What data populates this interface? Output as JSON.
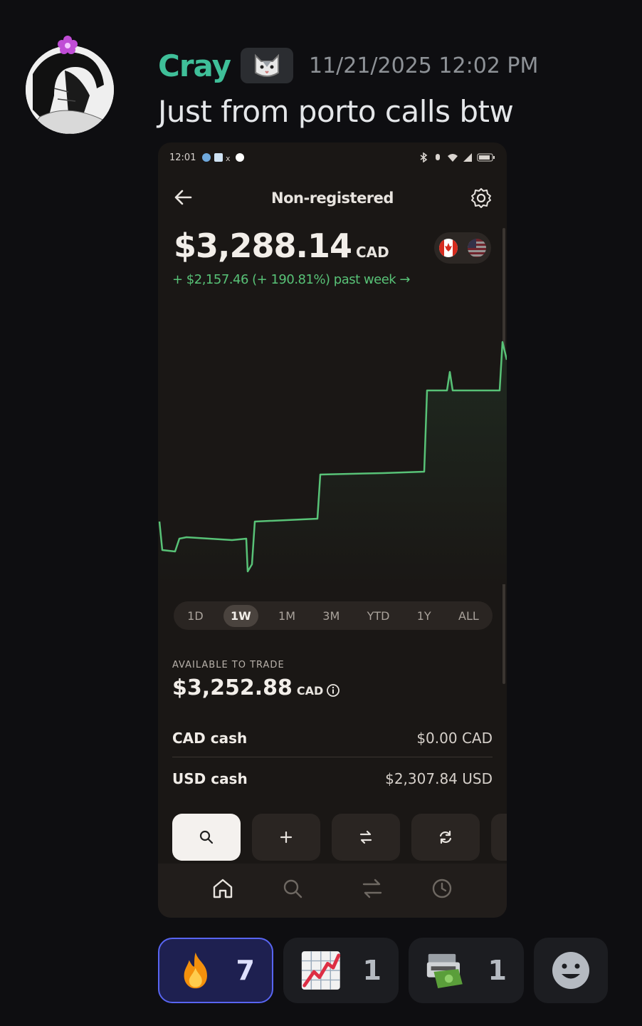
{
  "message": {
    "author": "Cray",
    "timestamp": "11/21/2025 12:02 PM",
    "text": "Just from porto calls btw"
  },
  "phone": {
    "status_time": "12:01",
    "account_title": "Non-registered",
    "balance": "$3,288.14",
    "balance_currency": "CAD",
    "change": "+ $2,157.46 (+ 190.81%) past week →",
    "ranges": [
      "1D",
      "1W",
      "1M",
      "3M",
      "YTD",
      "1Y",
      "ALL"
    ],
    "active_range": "1W",
    "available_label": "AVAILABLE TO TRADE",
    "available": "$3,252.88",
    "available_currency": "CAD",
    "cash_rows": [
      {
        "label": "CAD cash",
        "value": "$0.00 CAD"
      },
      {
        "label": "USD cash",
        "value": "$2,307.84 USD"
      }
    ],
    "action_icons": [
      "search-icon",
      "plus-icon",
      "transfer-icon",
      "refresh-icon"
    ],
    "nav_icons": [
      "home-icon",
      "search-icon",
      "transfer-icon",
      "history-icon"
    ]
  },
  "reactions": [
    {
      "emoji": "fire-icon",
      "count": "7",
      "selected": true
    },
    {
      "emoji": "chart-increasing-icon",
      "count": "1",
      "selected": false
    },
    {
      "emoji": "money-printer-icon",
      "count": "1",
      "selected": false
    }
  ],
  "colors": {
    "username": "#3fbf99",
    "gain": "#58c277",
    "reaction_selected": "#5865f2"
  }
}
